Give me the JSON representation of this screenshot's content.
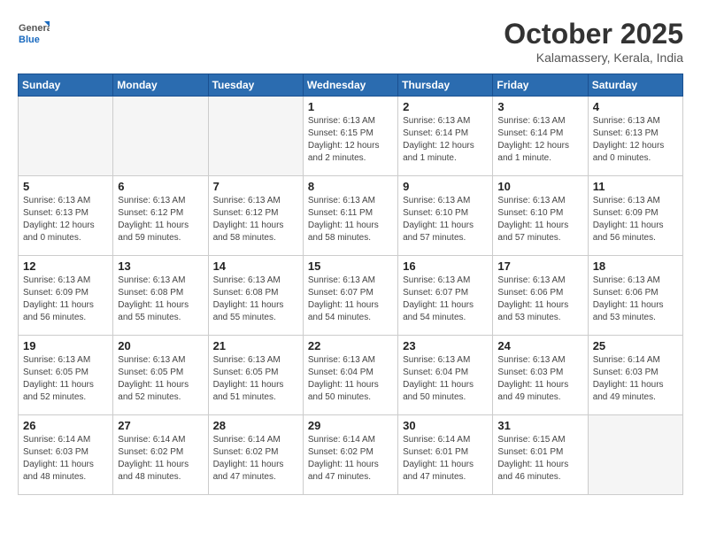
{
  "header": {
    "logo_general": "General",
    "logo_blue": "Blue",
    "month_title": "October 2025",
    "location": "Kalamassery, Kerala, India"
  },
  "weekdays": [
    "Sunday",
    "Monday",
    "Tuesday",
    "Wednesday",
    "Thursday",
    "Friday",
    "Saturday"
  ],
  "weeks": [
    [
      {
        "day": "",
        "info": ""
      },
      {
        "day": "",
        "info": ""
      },
      {
        "day": "",
        "info": ""
      },
      {
        "day": "1",
        "info": "Sunrise: 6:13 AM\nSunset: 6:15 PM\nDaylight: 12 hours\nand 2 minutes."
      },
      {
        "day": "2",
        "info": "Sunrise: 6:13 AM\nSunset: 6:14 PM\nDaylight: 12 hours\nand 1 minute."
      },
      {
        "day": "3",
        "info": "Sunrise: 6:13 AM\nSunset: 6:14 PM\nDaylight: 12 hours\nand 1 minute."
      },
      {
        "day": "4",
        "info": "Sunrise: 6:13 AM\nSunset: 6:13 PM\nDaylight: 12 hours\nand 0 minutes."
      }
    ],
    [
      {
        "day": "5",
        "info": "Sunrise: 6:13 AM\nSunset: 6:13 PM\nDaylight: 12 hours\nand 0 minutes."
      },
      {
        "day": "6",
        "info": "Sunrise: 6:13 AM\nSunset: 6:12 PM\nDaylight: 11 hours\nand 59 minutes."
      },
      {
        "day": "7",
        "info": "Sunrise: 6:13 AM\nSunset: 6:12 PM\nDaylight: 11 hours\nand 58 minutes."
      },
      {
        "day": "8",
        "info": "Sunrise: 6:13 AM\nSunset: 6:11 PM\nDaylight: 11 hours\nand 58 minutes."
      },
      {
        "day": "9",
        "info": "Sunrise: 6:13 AM\nSunset: 6:10 PM\nDaylight: 11 hours\nand 57 minutes."
      },
      {
        "day": "10",
        "info": "Sunrise: 6:13 AM\nSunset: 6:10 PM\nDaylight: 11 hours\nand 57 minutes."
      },
      {
        "day": "11",
        "info": "Sunrise: 6:13 AM\nSunset: 6:09 PM\nDaylight: 11 hours\nand 56 minutes."
      }
    ],
    [
      {
        "day": "12",
        "info": "Sunrise: 6:13 AM\nSunset: 6:09 PM\nDaylight: 11 hours\nand 56 minutes."
      },
      {
        "day": "13",
        "info": "Sunrise: 6:13 AM\nSunset: 6:08 PM\nDaylight: 11 hours\nand 55 minutes."
      },
      {
        "day": "14",
        "info": "Sunrise: 6:13 AM\nSunset: 6:08 PM\nDaylight: 11 hours\nand 55 minutes."
      },
      {
        "day": "15",
        "info": "Sunrise: 6:13 AM\nSunset: 6:07 PM\nDaylight: 11 hours\nand 54 minutes."
      },
      {
        "day": "16",
        "info": "Sunrise: 6:13 AM\nSunset: 6:07 PM\nDaylight: 11 hours\nand 54 minutes."
      },
      {
        "day": "17",
        "info": "Sunrise: 6:13 AM\nSunset: 6:06 PM\nDaylight: 11 hours\nand 53 minutes."
      },
      {
        "day": "18",
        "info": "Sunrise: 6:13 AM\nSunset: 6:06 PM\nDaylight: 11 hours\nand 53 minutes."
      }
    ],
    [
      {
        "day": "19",
        "info": "Sunrise: 6:13 AM\nSunset: 6:05 PM\nDaylight: 11 hours\nand 52 minutes."
      },
      {
        "day": "20",
        "info": "Sunrise: 6:13 AM\nSunset: 6:05 PM\nDaylight: 11 hours\nand 52 minutes."
      },
      {
        "day": "21",
        "info": "Sunrise: 6:13 AM\nSunset: 6:05 PM\nDaylight: 11 hours\nand 51 minutes."
      },
      {
        "day": "22",
        "info": "Sunrise: 6:13 AM\nSunset: 6:04 PM\nDaylight: 11 hours\nand 50 minutes."
      },
      {
        "day": "23",
        "info": "Sunrise: 6:13 AM\nSunset: 6:04 PM\nDaylight: 11 hours\nand 50 minutes."
      },
      {
        "day": "24",
        "info": "Sunrise: 6:13 AM\nSunset: 6:03 PM\nDaylight: 11 hours\nand 49 minutes."
      },
      {
        "day": "25",
        "info": "Sunrise: 6:14 AM\nSunset: 6:03 PM\nDaylight: 11 hours\nand 49 minutes."
      }
    ],
    [
      {
        "day": "26",
        "info": "Sunrise: 6:14 AM\nSunset: 6:03 PM\nDaylight: 11 hours\nand 48 minutes."
      },
      {
        "day": "27",
        "info": "Sunrise: 6:14 AM\nSunset: 6:02 PM\nDaylight: 11 hours\nand 48 minutes."
      },
      {
        "day": "28",
        "info": "Sunrise: 6:14 AM\nSunset: 6:02 PM\nDaylight: 11 hours\nand 47 minutes."
      },
      {
        "day": "29",
        "info": "Sunrise: 6:14 AM\nSunset: 6:02 PM\nDaylight: 11 hours\nand 47 minutes."
      },
      {
        "day": "30",
        "info": "Sunrise: 6:14 AM\nSunset: 6:01 PM\nDaylight: 11 hours\nand 47 minutes."
      },
      {
        "day": "31",
        "info": "Sunrise: 6:15 AM\nSunset: 6:01 PM\nDaylight: 11 hours\nand 46 minutes."
      },
      {
        "day": "",
        "info": ""
      }
    ]
  ]
}
